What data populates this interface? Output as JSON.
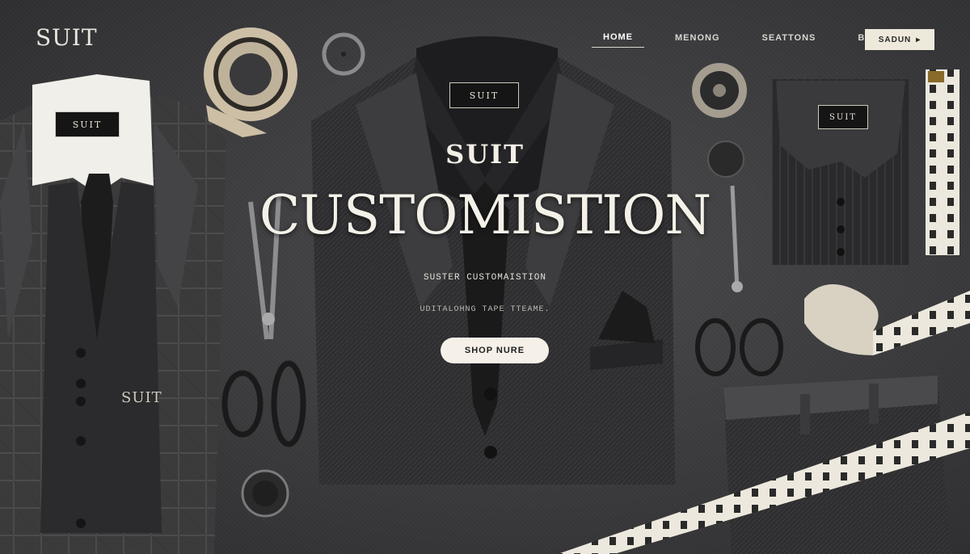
{
  "header": {
    "brand": "SUIT",
    "nav": [
      "HOME",
      "MENONG",
      "SEATTONS",
      "BEAVORS"
    ],
    "cta_label": "SADUN",
    "cta_icon": "chevron-icon"
  },
  "hero": {
    "kicker": "SUIT",
    "title": "CUSTOMISTION",
    "subtitle": "SUSTER CUSTOMAISTION",
    "subtitle2": "UDITALOHNG TAPE TTEAME.",
    "button": "SHOP NURE"
  },
  "labels": {
    "left_collar": "SUIT",
    "left_vest": "SUIT",
    "center_collar": "SUIT",
    "right_shirt": "SUIT"
  },
  "colors": {
    "background": "#3a3a3c",
    "accent": "#efe9dc",
    "text": "#f4f1e8"
  }
}
